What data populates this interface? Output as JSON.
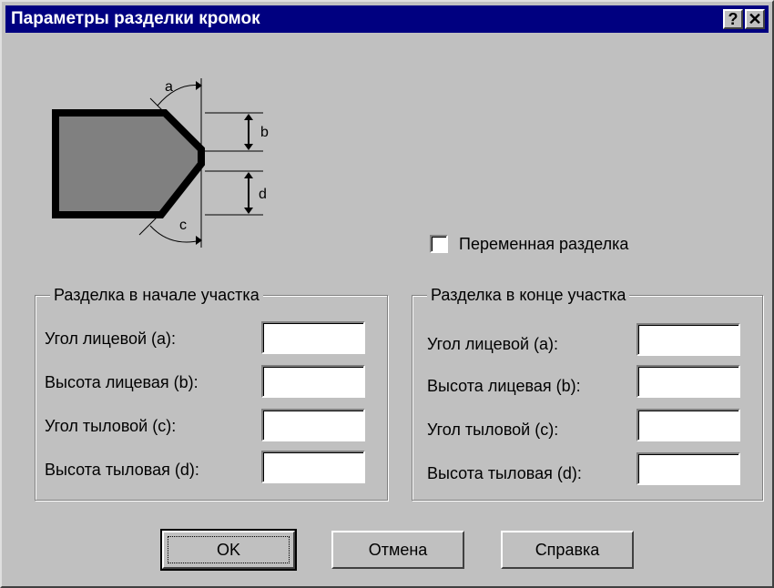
{
  "window": {
    "title": "Параметры разделки кромок",
    "help_button": "?",
    "close_button": "✕"
  },
  "diagram": {
    "labels": {
      "a": "a",
      "b": "b",
      "c": "c",
      "d": "d"
    }
  },
  "variable_bevel": {
    "label": "Переменная разделка",
    "checked": false
  },
  "start_group": {
    "title": "Разделка в начале участка",
    "fields": [
      {
        "label": "Угол лицевой (a):",
        "value": ""
      },
      {
        "label": "Высота лицевая (b):",
        "value": ""
      },
      {
        "label": "Угол тыловой (c):",
        "value": ""
      },
      {
        "label": "Высота тыловая (d):",
        "value": ""
      }
    ]
  },
  "end_group": {
    "title": "Разделка в конце участка",
    "fields": [
      {
        "label": "Угол лицевой (a):",
        "value": ""
      },
      {
        "label": "Высота лицевая (b):",
        "value": ""
      },
      {
        "label": "Угол тыловой (c):",
        "value": ""
      },
      {
        "label": "Высота тыловая (d):",
        "value": ""
      }
    ]
  },
  "buttons": {
    "ok": "OK",
    "cancel": "Отмена",
    "help": "Справка"
  },
  "colors": {
    "title_bar": "#000080",
    "face": "#c0c0c0",
    "plate_fill": "#808080"
  }
}
